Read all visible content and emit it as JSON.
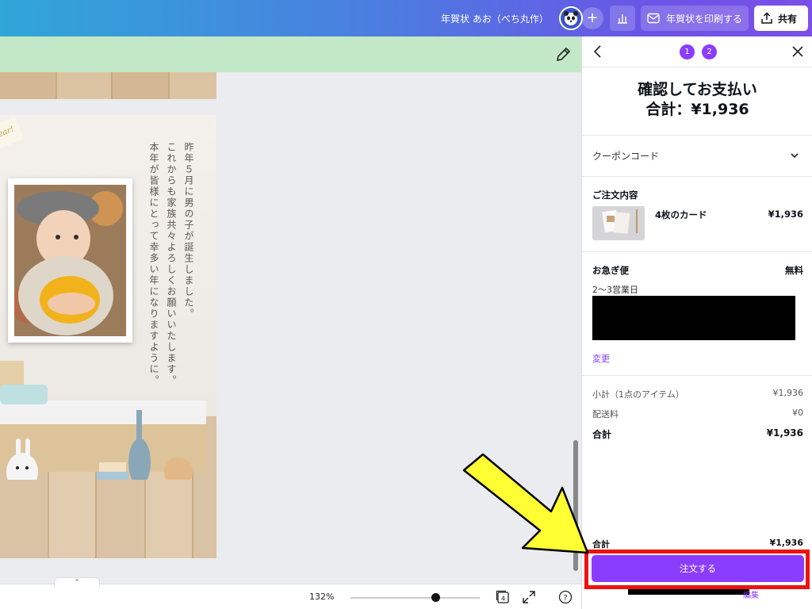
{
  "topbar": {
    "doc_title": "年賀状 あお（べち丸作）",
    "print_label": "年賀状を印刷する",
    "share_label": "共有"
  },
  "card": {
    "sticker_text": "ear!",
    "message_col1": "昨年５月に男の子が誕生しました。",
    "message_col2": "これからも家族共々よろしくお願いいたします。",
    "message_col3": "本年が皆様にとって幸多い年になりますように。"
  },
  "bottombar": {
    "zoom": "132%",
    "zoom_fraction": 0.66,
    "page_count": "4",
    "help": "?"
  },
  "panel": {
    "steps": [
      "1",
      "2"
    ],
    "title": "確認してお支払い",
    "total_heading": "合計：¥1,936",
    "coupon_label": "クーポンコード",
    "order_section": "ご注文内容",
    "item_name": "4枚のカード",
    "item_price": "¥1,936",
    "shipping_label": "お急ぎ便",
    "shipping_price": "無料",
    "shipping_days": "2〜3営業日",
    "change_link": "変更",
    "subtotal_label": "小計（1点のアイテム）",
    "subtotal_value": "¥1,936",
    "delivery_label": "配送料",
    "delivery_value": "¥0",
    "total_label": "合計",
    "total_value": "¥1,936",
    "footer_total_label": "合計",
    "footer_total_value": "¥1,936",
    "order_button": "注文する",
    "terms_link": "編集"
  },
  "colors": {
    "accent": "#8b3dff",
    "highlight_box": "#ee1111",
    "arrow_fill": "#ffff33",
    "green_bar": "#c3e8c8"
  }
}
